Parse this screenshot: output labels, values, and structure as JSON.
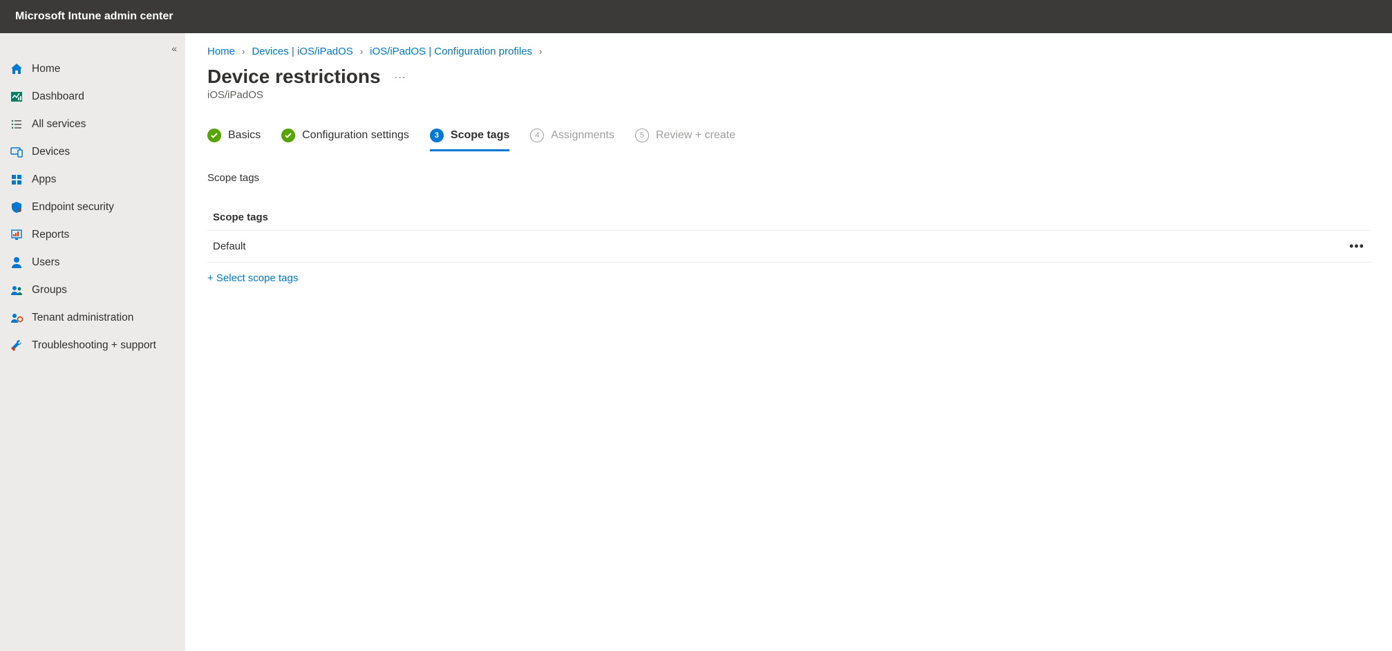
{
  "header": {
    "title": "Microsoft Intune admin center"
  },
  "sidebar": {
    "items": [
      {
        "label": "Home"
      },
      {
        "label": "Dashboard"
      },
      {
        "label": "All services"
      },
      {
        "label": "Devices"
      },
      {
        "label": "Apps"
      },
      {
        "label": "Endpoint security"
      },
      {
        "label": "Reports"
      },
      {
        "label": "Users"
      },
      {
        "label": "Groups"
      },
      {
        "label": "Tenant administration"
      },
      {
        "label": "Troubleshooting + support"
      }
    ]
  },
  "breadcrumbs": [
    {
      "label": "Home"
    },
    {
      "label": "Devices | iOS/iPadOS"
    },
    {
      "label": "iOS/iPadOS | Configuration profiles"
    }
  ],
  "page": {
    "title": "Device restrictions",
    "subtitle": "iOS/iPadOS"
  },
  "wizard": [
    {
      "label": "Basics",
      "state": "done"
    },
    {
      "label": "Configuration settings",
      "state": "done"
    },
    {
      "label": "Scope tags",
      "state": "current",
      "num": "3"
    },
    {
      "label": "Assignments",
      "state": "future",
      "num": "4"
    },
    {
      "label": "Review + create",
      "state": "future",
      "num": "5"
    }
  ],
  "section": {
    "label": "Scope tags",
    "table_header": "Scope tags",
    "rows": [
      {
        "value": "Default"
      }
    ],
    "select_button": "+ Select scope tags"
  }
}
